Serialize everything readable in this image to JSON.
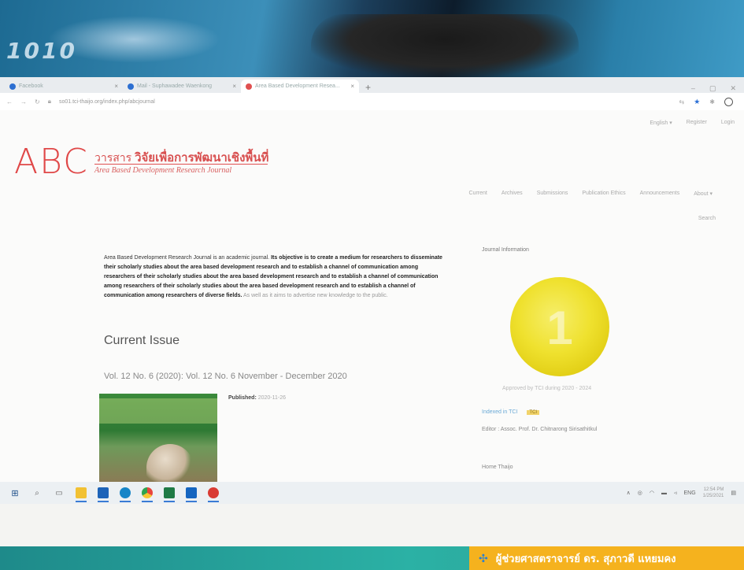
{
  "banner": {
    "digits": "1010"
  },
  "browser": {
    "tabs": [
      {
        "label": "Facebook"
      },
      {
        "label": "Mail - Suphawadee Waenkong"
      },
      {
        "label": "Area Based Development Resea..."
      }
    ],
    "new_tab": "+",
    "url": "so01.tci-thaijo.org/index.php/abcjournal"
  },
  "header": {
    "user_links": [
      "English",
      "Register",
      "Login"
    ],
    "logo": "ABC",
    "journal_name_prefix": "วารสาร",
    "journal_name_main": "วิจัยเพื่อการพัฒนาเชิงพื้นที่",
    "journal_name_en": "Area Based Development Research Journal",
    "nav": [
      "Current",
      "Archives",
      "Submissions",
      "Publication Ethics",
      "Announcements",
      "About"
    ],
    "search": "Search"
  },
  "main": {
    "about_intro": "Area Based Development Research Journal is an academic journal.",
    "about_bold": "Its objective is to create a medium for researchers to disseminate their scholarly studies about the area based development research and to establish a channel of communication among researchers of their scholarly studies about the area based development research and to establish a channel of communication among researchers of their scholarly studies about the area based development research and to establish a channel of communication among researchers of diverse fields.",
    "about_tail": "As well as it aims to advertise new knowledge to the public.",
    "current_issue_title": "Current Issue",
    "issue_title": "Vol. 12 No. 6 (2020): Vol. 12 No. 6 November - December 2020",
    "published_label": "Published:",
    "published_date": "2020-11-26"
  },
  "sidebar": {
    "title": "Journal Information",
    "medal_number": "1",
    "medal_caption": "Approved by TCI during 2020 - 2024",
    "indexed": "Indexed in TCI",
    "indexed_tag": "TCI",
    "editor": "Editor : Assoc. Prof. Dr. Chitnarong Sirisathitkul",
    "home": "Home Thaijo"
  },
  "taskbar": {
    "time": "12:54 PM",
    "date": "1/25/2021",
    "lang": "ENG"
  },
  "slide": {
    "presenter": "ผู้ช่วยศาสตราจารย์ ดร. สุภาวดี แหยมคง"
  }
}
